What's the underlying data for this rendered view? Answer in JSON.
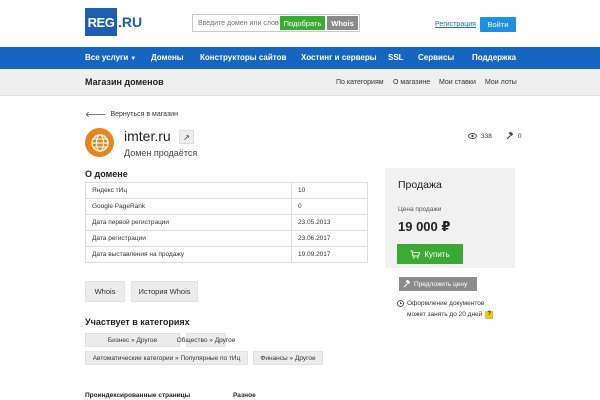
{
  "header": {
    "logo_main": "REG",
    "logo_suffix": ".RU",
    "search_placeholder": "Введите домен или слово",
    "pick_label": "Подобрать",
    "whois_label": "Whois",
    "register_link": "Регистрация",
    "login_label": "Войти"
  },
  "nav": {
    "items": [
      "Все услуги",
      "Домены",
      "Конструкторы сайтов",
      "Хостинг и серверы",
      "SSL",
      "Сервисы",
      "Поддержка"
    ]
  },
  "subnav": {
    "title": "Магазин доменов",
    "links": [
      "По категориям",
      "О магазине",
      "Мои ставки",
      "Мои лоты"
    ]
  },
  "back_label": "Вернуться в магазин",
  "domain": {
    "name": "imter.ru",
    "status": "Домен продаётся",
    "views": "338",
    "bids": "0",
    "ext_icon": "arrow-up-right-icon"
  },
  "about": {
    "title": "О домене",
    "rows": [
      {
        "label": "Яндекс тИц",
        "value": "10"
      },
      {
        "label": "Google PageRank",
        "value": "0"
      },
      {
        "label": "Дата первой регистрации",
        "value": "23.05.2013"
      },
      {
        "label": "Дата регистрации",
        "value": "23.06.2017"
      },
      {
        "label": "Дата выставления на продажу",
        "value": "19.09.2017"
      }
    ],
    "whois_btn": "Whois",
    "history_btn": "История Whois"
  },
  "categories": {
    "title": "Участвует в категориях",
    "tags": [
      "Бизнес » Другое",
      "Общество » Другое",
      "Автоматические категории » Популярные по тИц",
      "Финансы » Другое"
    ]
  },
  "footer": {
    "indexed": "Проиндексированные страницы",
    "other": "Разное"
  },
  "sale": {
    "title": "Продажа",
    "price_label": "Цена продажи",
    "price": "19 000 ₽",
    "buy_label": "Купить",
    "offer_label": "Предложить цену",
    "note_line1": "Оформление документов",
    "note_line2": "может занять до 20 дней",
    "note_qmark": "?"
  },
  "colors": {
    "brand_blue": "#1566c0",
    "green": "#3aaa35",
    "orange": "#e8841c"
  }
}
